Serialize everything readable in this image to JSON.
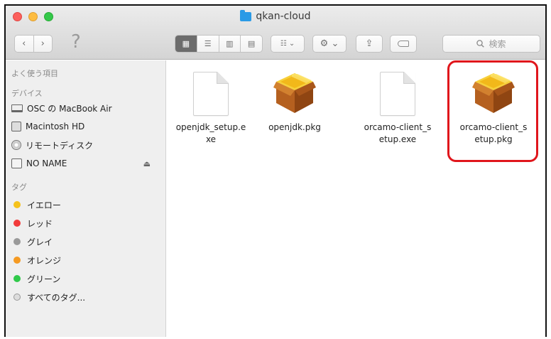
{
  "window": {
    "title": "qkan-cloud"
  },
  "toolbar": {
    "back": "‹",
    "forward": "›",
    "help": "?",
    "view_icon_glyph": "▦",
    "view_list_glyph": "☰",
    "view_column_glyph": "▥",
    "view_cover_glyph": "▤",
    "arrange_glyph": "☷ ⌄",
    "action_glyph": "⚙ ⌄",
    "share_glyph": "⇪",
    "search_placeholder": "検索"
  },
  "sidebar": {
    "favorites_header": "よく使う項目",
    "devices_header": "デバイス",
    "devices": [
      {
        "label": "OSC の MacBook Air",
        "icon": "laptop-icon"
      },
      {
        "label": "Macintosh HD",
        "icon": "hard-disk-icon"
      },
      {
        "label": "リモートディスク",
        "icon": "remote-disc-icon"
      },
      {
        "label": "NO NAME",
        "icon": "external-drive-icon"
      }
    ],
    "eject_glyph": "⏏",
    "tags_header": "タグ",
    "tags": [
      {
        "label": "イエロー",
        "color": "#f5c21b"
      },
      {
        "label": "レッド",
        "color": "#f23b3b"
      },
      {
        "label": "グレイ",
        "color": "#9a9a9a"
      },
      {
        "label": "オレンジ",
        "color": "#f59a22"
      },
      {
        "label": "グリーン",
        "color": "#30c94a"
      },
      {
        "label": "すべてのタグ...",
        "color": "#dddddd"
      }
    ]
  },
  "files": [
    {
      "name": "openjdk_setup.exe",
      "kind": "document"
    },
    {
      "name": "openjdk.pkg",
      "kind": "package"
    },
    {
      "name": "orcamo-client_setup.exe",
      "kind": "document"
    },
    {
      "name": "orcamo-client_setup.pkg",
      "kind": "package",
      "highlighted": true
    }
  ],
  "colors": {
    "highlight": "#e0161c",
    "folder": "#2a9ae6"
  }
}
